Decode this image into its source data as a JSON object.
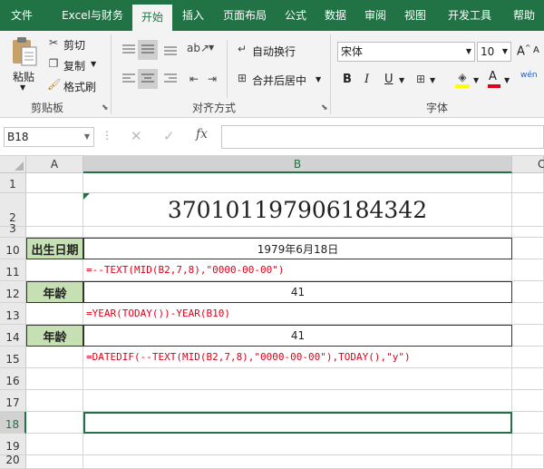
{
  "menu": {
    "tabs": [
      {
        "label": "文件"
      },
      {
        "label": "Excel与财务"
      },
      {
        "label": "开始"
      },
      {
        "label": "插入"
      },
      {
        "label": "页面布局"
      },
      {
        "label": "公式"
      },
      {
        "label": "数据"
      },
      {
        "label": "审阅"
      },
      {
        "label": "视图"
      },
      {
        "label": "开发工具"
      },
      {
        "label": "帮助"
      }
    ],
    "active_tab": "开始"
  },
  "ribbon": {
    "clipboard": {
      "paste_label": "粘贴",
      "cut_label": "剪切",
      "copy_label": "复制",
      "format_painter_label": "格式刷",
      "group_label": "剪贴板"
    },
    "alignment": {
      "wrap_text_label": "自动换行",
      "merge_center_label": "合并后居中",
      "group_label": "对齐方式"
    },
    "font": {
      "font_name": "宋体",
      "font_size": "10",
      "bold": "B",
      "italic": "I",
      "underline": "U",
      "grow_font": "A",
      "shrink_font": "A",
      "font_color_letter": "A",
      "phonetic": "wén",
      "group_label": "字体"
    }
  },
  "formula_bar": {
    "name_box": "B18",
    "fx_label": "fx",
    "formula": ""
  },
  "sheet": {
    "columns": [
      {
        "label": ""
      },
      {
        "label": "A"
      },
      {
        "label": "B"
      },
      {
        "label": "C"
      }
    ],
    "rows": [
      {
        "num": "1"
      },
      {
        "num": "2"
      },
      {
        "num": "3"
      },
      {
        "num": "10"
      },
      {
        "num": "11"
      },
      {
        "num": "12"
      },
      {
        "num": "13"
      },
      {
        "num": "14"
      },
      {
        "num": "15"
      },
      {
        "num": "16"
      },
      {
        "num": "17"
      },
      {
        "num": "18"
      },
      {
        "num": "19"
      },
      {
        "num": "20"
      }
    ],
    "cells": {
      "B2": "370101197906184342",
      "A10": "出生日期",
      "B10": "1979年6月18日",
      "B11": "=--TEXT(MID(B2,7,8),\"0000-00-00\")",
      "A12": "年龄",
      "B12": "41",
      "B13": "=YEAR(TODAY())-YEAR(B10)",
      "A14": "年龄",
      "B14": "41",
      "B15": "=DATEDIF(--TEXT(MID(B2,7,8),\"0000-00-00\"),TODAY(),\"y\")"
    }
  },
  "colors": {
    "accent": "#217346",
    "label_fill": "#c6e0b4",
    "formula_text": "#e0001a"
  }
}
